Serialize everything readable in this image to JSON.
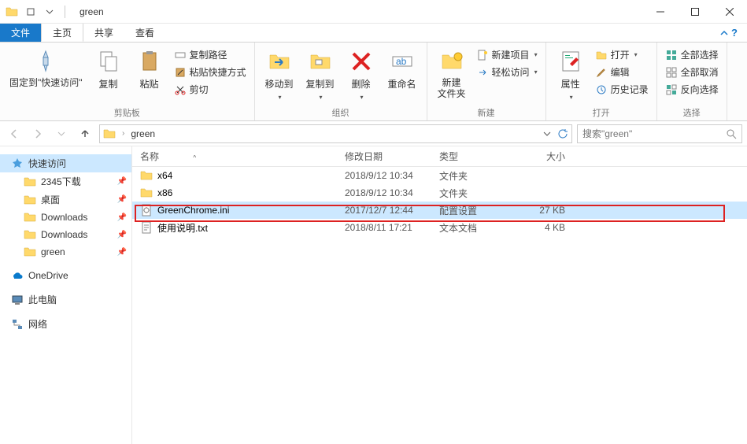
{
  "title": "green",
  "tabs": {
    "file": "文件",
    "home": "主页",
    "share": "共享",
    "view": "查看"
  },
  "ribbon": {
    "pin_quick": "固定到\"快速访问\"",
    "copy": "复制",
    "paste": "粘贴",
    "copy_path": "复制路径",
    "paste_shortcut": "粘贴快捷方式",
    "cut": "剪切",
    "clipboard_label": "剪贴板",
    "move_to": "移动到",
    "copy_to": "复制到",
    "delete": "删除",
    "rename": "重命名",
    "organize_label": "组织",
    "new_folder": "新建\n文件夹",
    "new_item": "新建项目",
    "easy_access": "轻松访问",
    "new_label": "新建",
    "properties": "属性",
    "open": "打开",
    "edit": "编辑",
    "history": "历史记录",
    "open_label": "打开",
    "select_all": "全部选择",
    "select_none": "全部取消",
    "invert": "反向选择",
    "select_label": "选择"
  },
  "breadcrumb": {
    "current": "green"
  },
  "search": {
    "placeholder": "搜索\"green\""
  },
  "sidebar": {
    "quick_access": "快速访问",
    "items": [
      {
        "label": "2345下载"
      },
      {
        "label": "桌面"
      },
      {
        "label": "Downloads"
      },
      {
        "label": "Downloads"
      },
      {
        "label": "green"
      }
    ],
    "onedrive": "OneDrive",
    "thispc": "此电脑",
    "network": "网络"
  },
  "columns": {
    "name": "名称",
    "date": "修改日期",
    "type": "类型",
    "size": "大小"
  },
  "files": [
    {
      "name": "x64",
      "date": "2018/9/12 10:34",
      "type": "文件夹",
      "size": "",
      "icon": "folder"
    },
    {
      "name": "x86",
      "date": "2018/9/12 10:34",
      "type": "文件夹",
      "size": "",
      "icon": "folder"
    },
    {
      "name": "GreenChrome.ini",
      "date": "2017/12/7 12:44",
      "type": "配置设置",
      "size": "27 KB",
      "icon": "ini",
      "selected": true
    },
    {
      "name": "使用说明.txt",
      "date": "2018/8/11 17:21",
      "type": "文本文档",
      "size": "4 KB",
      "icon": "txt"
    }
  ]
}
